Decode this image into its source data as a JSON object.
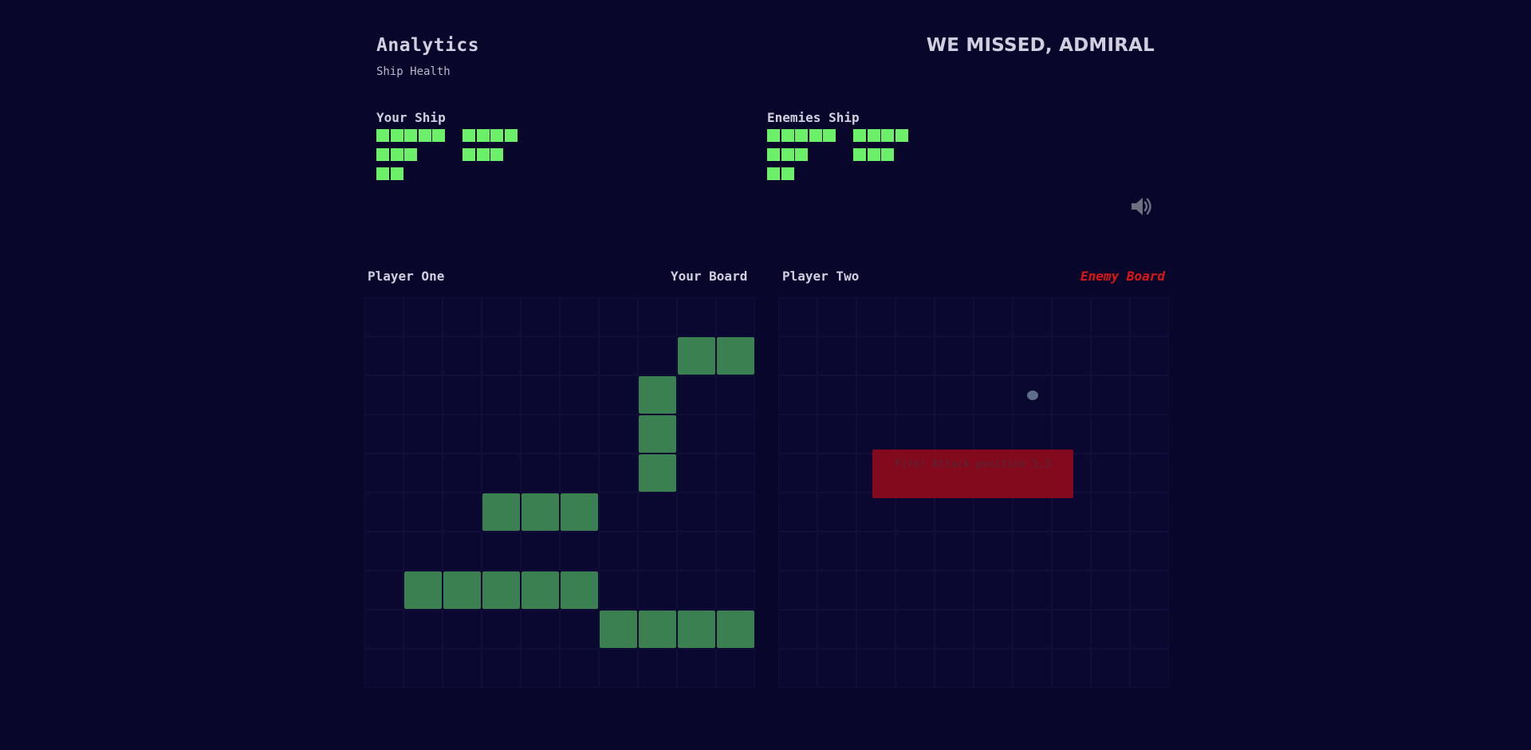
{
  "header": {
    "title": "Analytics",
    "subtitle": "Ship Health",
    "status": "WE MISSED, ADMIRAL"
  },
  "health": {
    "player": {
      "label": "Your Ship",
      "ships": [
        5,
        4,
        3,
        3,
        2
      ]
    },
    "enemy": {
      "label": "Enemies Ship",
      "ships": [
        5,
        4,
        3,
        3,
        2
      ]
    }
  },
  "sound": {
    "icon": "speaker-volume-icon",
    "color": "#6b6f7e"
  },
  "boards": {
    "player": {
      "player_label": "Player One",
      "board_label": "Your Board",
      "ship_cells": [
        [
          1,
          8
        ],
        [
          1,
          9
        ],
        [
          2,
          7
        ],
        [
          3,
          7
        ],
        [
          4,
          7
        ],
        [
          5,
          3
        ],
        [
          5,
          4
        ],
        [
          5,
          5
        ],
        [
          7,
          1
        ],
        [
          7,
          2
        ],
        [
          7,
          3
        ],
        [
          7,
          4
        ],
        [
          7,
          5
        ],
        [
          8,
          6
        ],
        [
          8,
          7
        ],
        [
          8,
          8
        ],
        [
          8,
          9
        ]
      ]
    },
    "enemy": {
      "player_label": "Player Two",
      "board_label": "Enemy Board",
      "miss_cells": [
        [
          2,
          6
        ]
      ],
      "popup_text": "Fire! Attack position 5,3"
    }
  },
  "colors": {
    "background": "#08062a",
    "ship": "#3a8050",
    "health": "#6cf06a",
    "enemy_label": "#e01417",
    "miss": "#5c6e89",
    "popup": "#8a0a1c"
  }
}
